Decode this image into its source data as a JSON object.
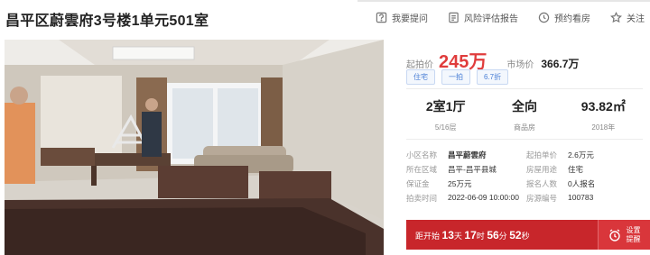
{
  "header": {
    "title": "昌平区蔚雲府3号楼1单元501室",
    "actions": [
      {
        "label": "我要提问",
        "icon": "question-icon"
      },
      {
        "label": "风险评估报告",
        "icon": "report-icon"
      },
      {
        "label": "预约看房",
        "icon": "clock-icon"
      },
      {
        "label": "关注",
        "icon": "star-icon"
      }
    ]
  },
  "price": {
    "start_label": "起拍价",
    "start_value": "245万",
    "market_label": "市场价",
    "market_value": "366.7万"
  },
  "tags": [
    "住宅",
    "一拍",
    "6.7折"
  ],
  "stats": [
    {
      "value": "2室1厅",
      "sub": "5/16层"
    },
    {
      "value": "全向",
      "sub": "商品房"
    },
    {
      "value": "93.82㎡",
      "sub": "2018年"
    }
  ],
  "info": [
    [
      {
        "k": "小区名称",
        "v": "昌平蔚雲府",
        "bold": true
      },
      {
        "k": "起拍单价",
        "v": "2.6万元"
      }
    ],
    [
      {
        "k": "所在区域",
        "v": "昌平-昌平县城"
      },
      {
        "k": "房屋用途",
        "v": "住宅"
      }
    ],
    [
      {
        "k": "保证金",
        "v": "25万元"
      },
      {
        "k": "报名人数",
        "v": "0人报名"
      }
    ],
    [
      {
        "k": "拍卖时间",
        "v": "2022-06-09 10:00:00"
      },
      {
        "k": "房源编号",
        "v": "100783"
      }
    ]
  ],
  "countdown": {
    "prefix": "距开始",
    "days": "13",
    "days_unit": "天",
    "hours": "17",
    "hours_unit": "时",
    "minutes": "56",
    "minutes_unit": "分",
    "seconds": "52",
    "seconds_unit": "秒",
    "remind_label": "设置提醒"
  },
  "colors": {
    "accent_red": "#e03c3c",
    "countdown_bg": "#c8262b",
    "tag_blue": "#4a7fd6"
  }
}
